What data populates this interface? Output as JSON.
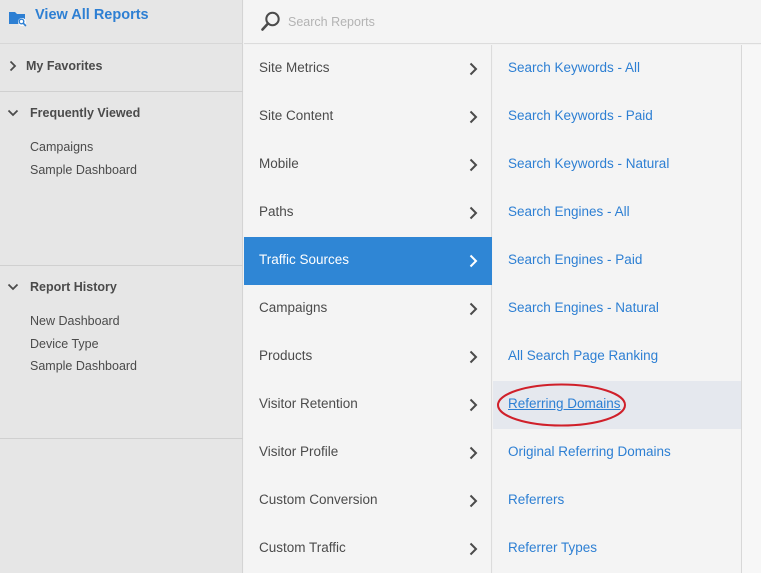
{
  "sidebar": {
    "view_all": "View All Reports",
    "favorites": {
      "label": "My Favorites"
    },
    "frequently_viewed": {
      "label": "Frequently Viewed",
      "items": [
        "Campaigns",
        "Sample Dashboard"
      ]
    },
    "report_history": {
      "label": "Report History",
      "items": [
        "New Dashboard",
        "Device Type",
        "Sample Dashboard"
      ]
    }
  },
  "search": {
    "placeholder": "Search Reports",
    "value": ""
  },
  "categories": [
    {
      "label": "Site Metrics"
    },
    {
      "label": "Site Content"
    },
    {
      "label": "Mobile"
    },
    {
      "label": "Paths"
    },
    {
      "label": "Traffic Sources",
      "active": true
    },
    {
      "label": "Campaigns"
    },
    {
      "label": "Products"
    },
    {
      "label": "Visitor Retention"
    },
    {
      "label": "Visitor Profile"
    },
    {
      "label": "Custom Conversion"
    },
    {
      "label": "Custom Traffic"
    }
  ],
  "reports": [
    {
      "label": "Search Keywords - All"
    },
    {
      "label": "Search Keywords - Paid"
    },
    {
      "label": "Search Keywords - Natural"
    },
    {
      "label": "Search Engines - All"
    },
    {
      "label": "Search Engines - Paid"
    },
    {
      "label": "Search Engines - Natural"
    },
    {
      "label": "All Search Page Ranking"
    },
    {
      "label": "Referring Domains",
      "highlighted": true
    },
    {
      "label": "Original Referring Domains"
    },
    {
      "label": "Referrers"
    },
    {
      "label": "Referrer Types"
    }
  ],
  "colors": {
    "accent": "#2f86d5",
    "link": "#2d7fd3",
    "annotation": "#d0202a"
  },
  "icons": {
    "view_all": "reports-folder-icon",
    "search": "search-icon",
    "category_chevron": "chevron-right-icon",
    "section_expanded": "chevron-down-icon",
    "section_collapsed": "chevron-right-icon"
  }
}
